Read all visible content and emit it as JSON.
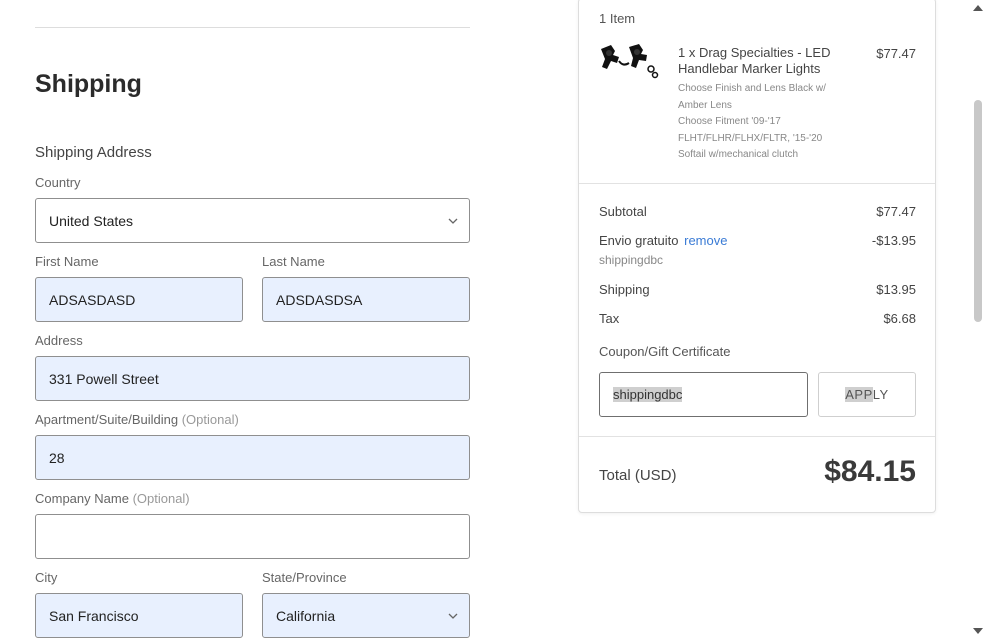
{
  "shipping": {
    "title": "Shipping",
    "address_heading": "Shipping Address",
    "country_label": "Country",
    "country_value": "United States",
    "first_name_label": "First Name",
    "first_name_value": "ADSASDASD",
    "last_name_label": "Last Name",
    "last_name_value": "ADSDASDSA",
    "address_label": "Address",
    "address_value": "331 Powell Street",
    "apt_label": "Apartment/Suite/Building",
    "apt_optional": "(Optional)",
    "apt_value": "28",
    "company_label": "Company Name",
    "company_optional": "(Optional)",
    "company_value": "",
    "city_label": "City",
    "city_value": "San Francisco",
    "state_label": "State/Province",
    "state_value": "California"
  },
  "summary": {
    "items_count": "1 Item",
    "product": {
      "name": "1 x Drag Specialties - LED Handlebar Marker Lights",
      "price": "$77.47",
      "options": [
        "Choose Finish and Lens Black w/ Amber Lens",
        "Choose Fitment '09-'17 FLHT/FLHR/FLHX/FLTR, '15-'20 Softail w/mechanical clutch"
      ]
    },
    "subtotal_label": "Subtotal",
    "subtotal_value": "$77.47",
    "discount_label": "Envio gratuito",
    "discount_remove": "remove",
    "discount_value": "-$13.95",
    "discount_code": "shippingdbc",
    "shipping_label": "Shipping",
    "shipping_value": "$13.95",
    "tax_label": "Tax",
    "tax_value": "$6.68",
    "coupon_label": "Coupon/Gift Certificate",
    "coupon_value": "shippingdbc",
    "apply_label_hl": "APP",
    "apply_label_rest": "LY",
    "total_label": "Total (USD)",
    "total_value": "$84.15"
  },
  "colors": {
    "autofill_bg": "#e8f0fe",
    "link": "#3a7bd5"
  },
  "icons": {
    "select_arrow": "chevron-down-icon",
    "scroll_up": "scroll-up-arrow-icon",
    "scroll_down": "scroll-down-arrow-icon"
  }
}
